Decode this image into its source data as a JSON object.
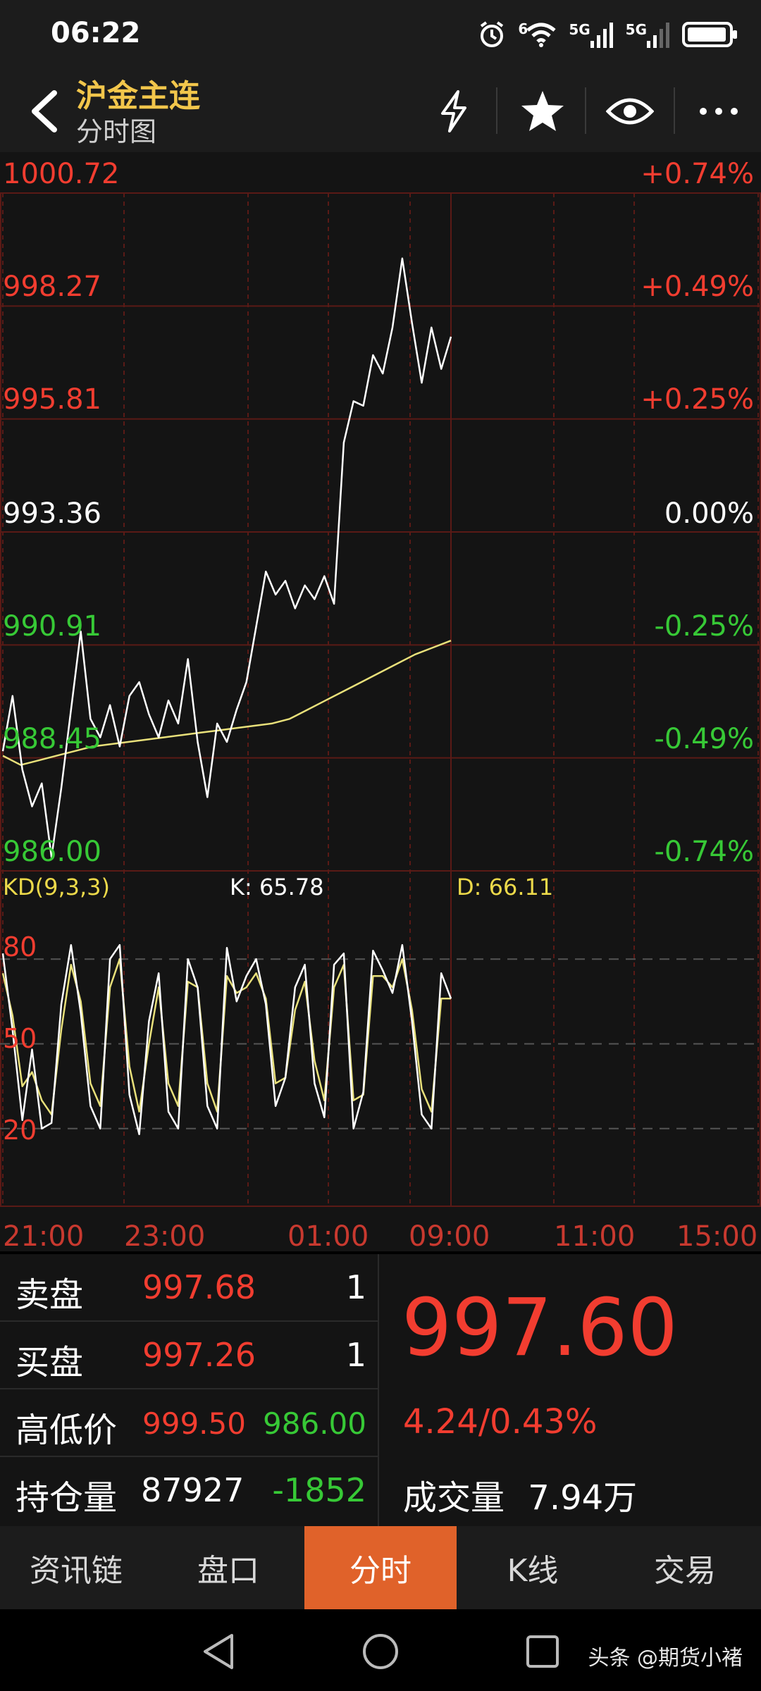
{
  "status_bar": {
    "time": "06:22",
    "signal_1": "5G",
    "signal_2": "5G",
    "wifi_badge": "6"
  },
  "header": {
    "title": "沪金主连",
    "subtitle": "分时图"
  },
  "chart": {
    "price_levels": [
      "1000.72",
      "998.27",
      "995.81",
      "993.36",
      "990.91",
      "988.45",
      "986.00"
    ],
    "pct_levels": [
      "+0.74%",
      "+0.49%",
      "+0.25%",
      "0.00%",
      "-0.25%",
      "-0.49%",
      "-0.74%"
    ],
    "kd_title": "KD(9,3,3)",
    "k_value": "K: 65.78",
    "d_value": "D: 66.11",
    "kd_ticks": [
      "80",
      "50",
      "20"
    ],
    "time_labels": [
      "21:00",
      "23:00",
      "01:00",
      "09:00",
      "11:00",
      "15:00"
    ],
    "colors": {
      "up": "#f23d30",
      "down": "#37c936",
      "price_line": "#ffffff",
      "avg_line": "#e8e07a",
      "k_line": "#ffffff",
      "d_line": "#e8e07a",
      "grid": "#5a1a16"
    }
  },
  "chart_data": {
    "type": "line",
    "title": "",
    "xlabel": "",
    "ylabel": "",
    "ylim": [
      986.0,
      1000.72
    ],
    "x_ticks": [
      "21:00",
      "23:00",
      "01:00",
      "09:00",
      "11:00",
      "15:00"
    ],
    "series": [],
    "price": [
      988.6,
      989.8,
      988.2,
      987.4,
      987.9,
      986.3,
      987.8,
      989.5,
      991.2,
      989.3,
      988.9,
      989.6,
      988.7,
      989.8,
      990.1,
      989.4,
      988.9,
      989.7,
      989.2,
      990.6,
      988.8,
      987.6,
      989.2,
      988.8,
      989.5,
      990.1,
      991.3,
      992.5,
      992.0,
      992.3,
      991.7,
      992.2,
      991.9,
      992.4,
      991.8,
      995.3,
      996.2,
      996.1,
      997.2,
      996.8,
      997.8,
      999.3,
      997.9,
      996.6,
      997.8,
      996.9,
      997.6
    ],
    "average": [
      988.5,
      988.3,
      988.4,
      988.5,
      988.6,
      988.7,
      988.75,
      988.8,
      988.85,
      988.9,
      988.95,
      989.0,
      989.05,
      989.1,
      989.15,
      989.2,
      989.3,
      989.5,
      989.7,
      989.9,
      990.1,
      990.3,
      990.5,
      990.7,
      990.85,
      991.0
    ],
    "k": [
      82,
      55,
      23,
      48,
      20,
      22,
      64,
      85,
      61,
      28,
      20,
      80,
      85,
      32,
      18,
      58,
      75,
      26,
      20,
      80,
      70,
      28,
      20,
      84,
      65,
      74,
      80,
      64,
      28,
      38,
      70,
      78,
      36,
      24,
      78,
      82,
      20,
      33,
      83,
      76,
      68,
      85,
      58,
      25,
      20,
      75,
      66
    ],
    "d": [
      75,
      60,
      35,
      40,
      30,
      25,
      55,
      78,
      65,
      36,
      28,
      70,
      80,
      42,
      26,
      50,
      70,
      36,
      28,
      72,
      70,
      36,
      26,
      74,
      68,
      70,
      75,
      66,
      36,
      38,
      62,
      72,
      44,
      30,
      70,
      78,
      30,
      32,
      74,
      74,
      70,
      80,
      62,
      34,
      26,
      66,
      66
    ]
  },
  "quote": {
    "sell_label": "卖盘",
    "sell_price": "997.68",
    "sell_qty": "1",
    "buy_label": "买盘",
    "buy_price": "997.26",
    "buy_qty": "1",
    "hl_label": "高低价",
    "high": "999.50",
    "low": "986.00",
    "oi_label": "持仓量",
    "oi_value": "87927",
    "oi_change": "-1852",
    "last_price": "997.60",
    "change": "4.24/0.43%",
    "volume_label": "成交量",
    "volume_value": "7.94万"
  },
  "tabs": [
    {
      "label": "资讯链",
      "active": false
    },
    {
      "label": "盘口",
      "active": false
    },
    {
      "label": "分时",
      "active": true
    },
    {
      "label": "K线",
      "active": false
    },
    {
      "label": "交易",
      "active": false
    }
  ],
  "watermark": "头条 @期货小褚"
}
